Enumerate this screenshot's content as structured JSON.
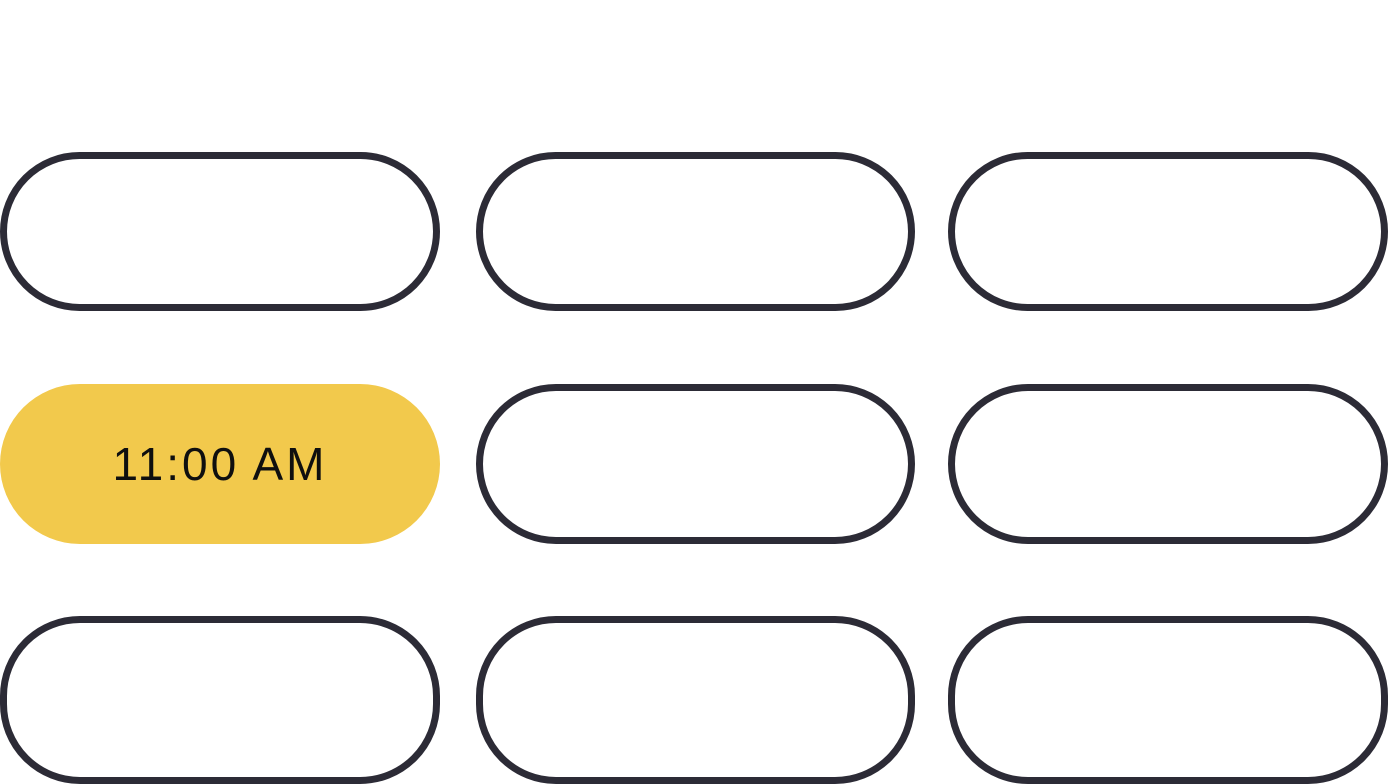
{
  "time_slots": [
    {
      "label": "",
      "selected": false
    },
    {
      "label": "",
      "selected": false
    },
    {
      "label": "",
      "selected": false
    },
    {
      "label": "11:00 AM",
      "selected": true
    },
    {
      "label": "",
      "selected": false
    },
    {
      "label": "",
      "selected": false
    },
    {
      "label": "",
      "selected": false
    },
    {
      "label": "",
      "selected": false
    },
    {
      "label": "",
      "selected": false
    }
  ],
  "colors": {
    "selected_fill": "#f2c94c",
    "outline": "#2c2b36",
    "text": "#0f0f0f",
    "background": "#ffffff"
  }
}
